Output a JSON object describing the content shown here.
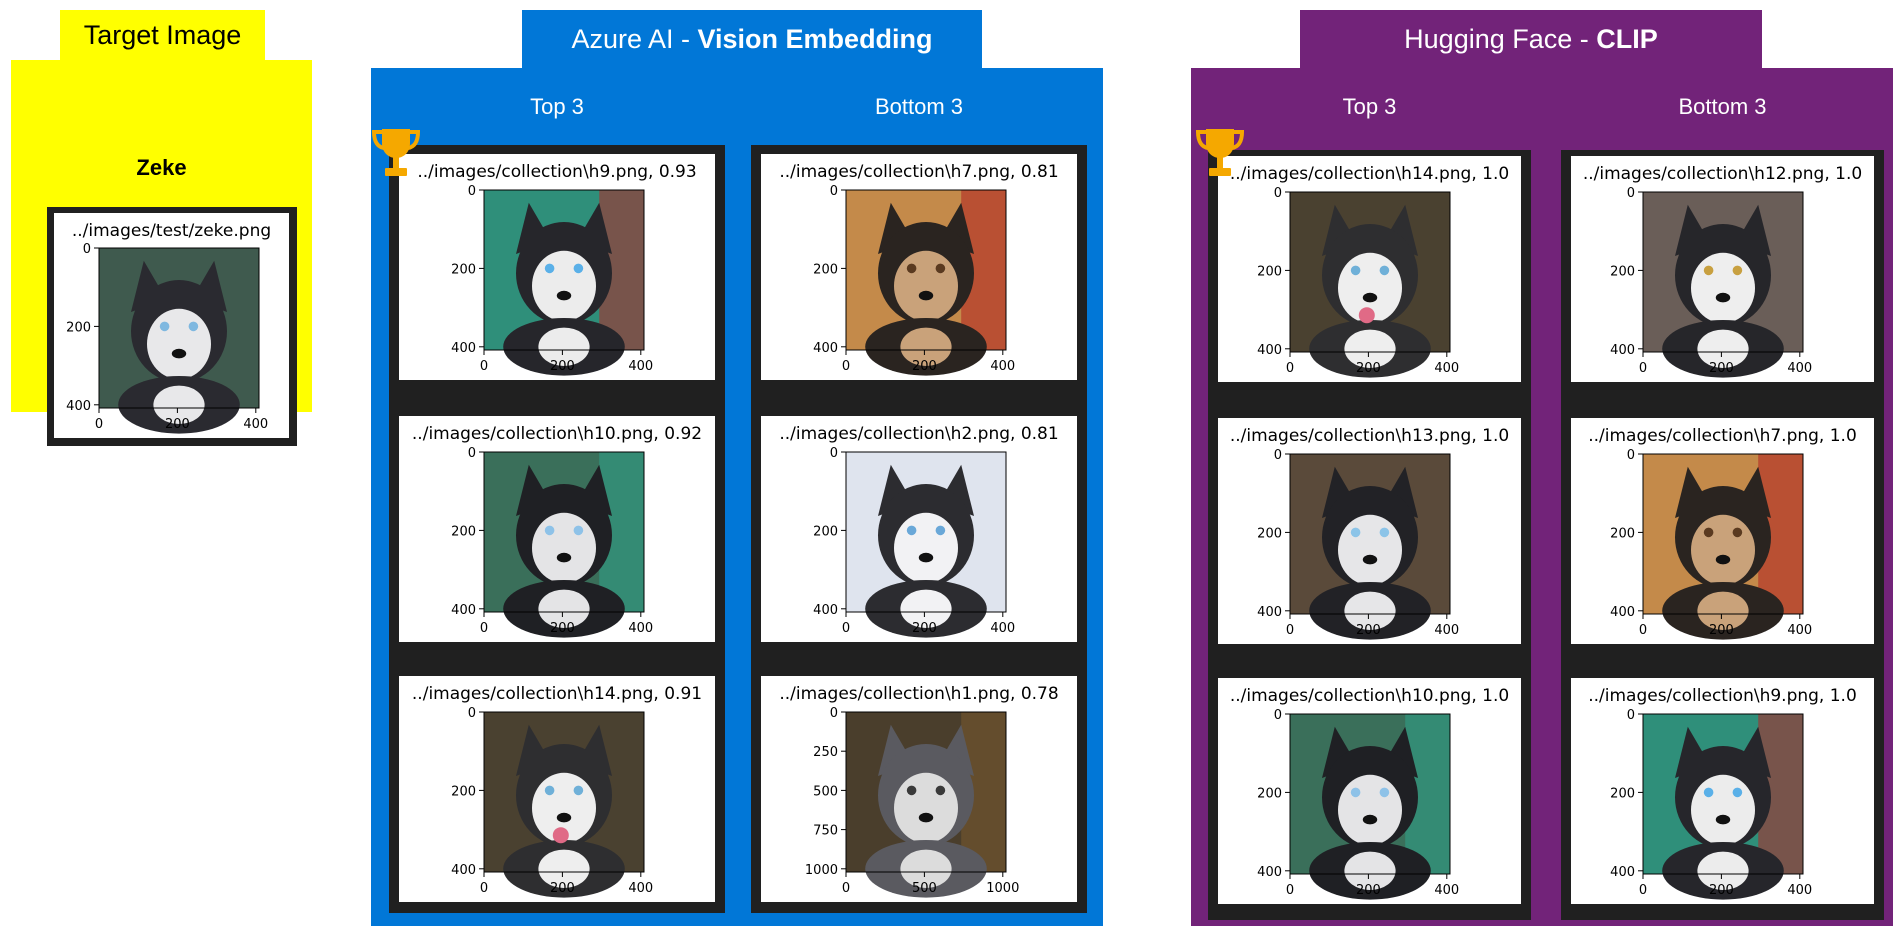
{
  "target": {
    "tab_label": "Target Image",
    "name": "Zeke",
    "panel": {
      "title": "../images/test/zeke.png",
      "xticks": [
        "0",
        "200",
        "400"
      ],
      "yticks": [
        "0",
        "200",
        "400"
      ],
      "photo": "husky-looking-up"
    }
  },
  "azure": {
    "tab_prefix": "Azure AI - ",
    "tab_bold": "Vision Embedding",
    "color": "#0177d7",
    "top_label": "Top 3",
    "bottom_label": "Bottom 3",
    "trophy_icon": "trophy-icon",
    "top": [
      {
        "title": "../images/collection\\h9.png, 0.93",
        "xticks": [
          "0",
          "200",
          "400"
        ],
        "yticks": [
          "0",
          "200",
          "400"
        ],
        "photo": "husky-profile-blue-eye"
      },
      {
        "title": "../images/collection\\h10.png, 0.92",
        "xticks": [
          "0",
          "200",
          "400"
        ],
        "yticks": [
          "0",
          "200",
          "400"
        ],
        "photo": "husky-by-green-fence"
      },
      {
        "title": "../images/collection\\h14.png, 0.91",
        "xticks": [
          "0",
          "200",
          "400"
        ],
        "yticks": [
          "0",
          "200",
          "400"
        ],
        "photo": "husky-tongue-out"
      }
    ],
    "bottom": [
      {
        "title": "../images/collection\\h7.png, 0.81",
        "xticks": [
          "0",
          "200",
          "400"
        ],
        "yticks": [
          "0",
          "200",
          "400"
        ],
        "photo": "mixed-breed-dog-red-collar"
      },
      {
        "title": "../images/collection\\h2.png, 0.81",
        "xticks": [
          "0",
          "200",
          "400"
        ],
        "yticks": [
          "0",
          "200",
          "400"
        ],
        "photo": "husky-in-snow"
      },
      {
        "title": "../images/collection\\h1.png, 0.78",
        "xticks": [
          "0",
          "500",
          "1000"
        ],
        "yticks": [
          "0",
          "250",
          "500",
          "750",
          "1000"
        ],
        "photo": "husky-running-with-stick"
      }
    ]
  },
  "hf": {
    "tab_prefix": "Hugging Face - ",
    "tab_bold": "CLIP",
    "color": "#722379",
    "top_label": "Top 3",
    "bottom_label": "Bottom 3",
    "trophy_icon": "trophy-icon",
    "top": [
      {
        "title": "../images/collection\\h14.png, 1.0",
        "xticks": [
          "0",
          "200",
          "400"
        ],
        "yticks": [
          "0",
          "200",
          "400"
        ],
        "photo": "husky-tongue-out"
      },
      {
        "title": "../images/collection\\h13.png, 1.0",
        "xticks": [
          "0",
          "200",
          "400"
        ],
        "yticks": [
          "0",
          "200",
          "400"
        ],
        "photo": "husky-standing-dirt"
      },
      {
        "title": "../images/collection\\h10.png, 1.0",
        "xticks": [
          "0",
          "200",
          "400"
        ],
        "yticks": [
          "0",
          "200",
          "400"
        ],
        "photo": "husky-by-green-fence"
      }
    ],
    "bottom": [
      {
        "title": "../images/collection\\h12.png, 1.0",
        "xticks": [
          "0",
          "200",
          "400"
        ],
        "yticks": [
          "0",
          "200",
          "400"
        ],
        "photo": "husky-sitting"
      },
      {
        "title": "../images/collection\\h7.png, 1.0",
        "xticks": [
          "0",
          "200",
          "400"
        ],
        "yticks": [
          "0",
          "200",
          "400"
        ],
        "photo": "mixed-breed-dog-red-collar"
      },
      {
        "title": "../images/collection\\h9.png, 1.0",
        "xticks": [
          "0",
          "200",
          "400"
        ],
        "yticks": [
          "0",
          "200",
          "400"
        ],
        "photo": "husky-profile-blue-eye"
      }
    ]
  }
}
